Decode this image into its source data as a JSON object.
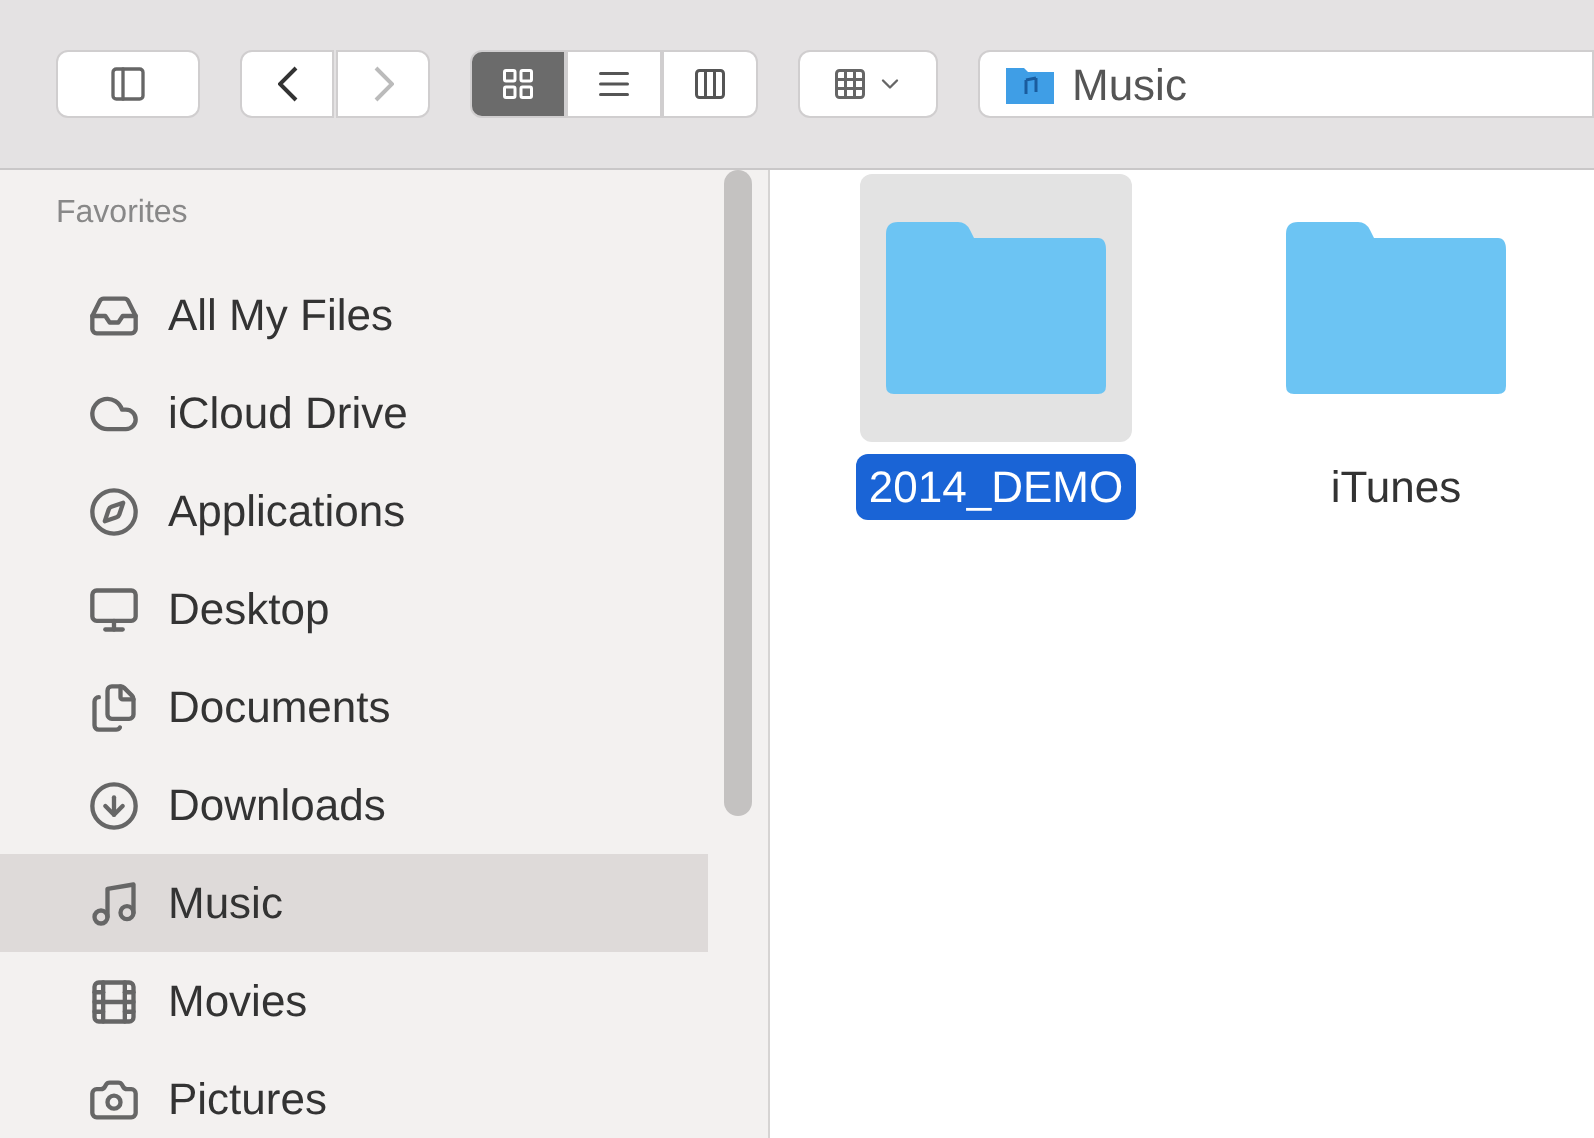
{
  "toolbar": {
    "view_modes": [
      {
        "kind": "icon",
        "selected": true
      },
      {
        "kind": "list",
        "selected": false
      },
      {
        "kind": "columns",
        "selected": false
      }
    ],
    "path": "Music"
  },
  "sidebar": {
    "heading": "Favorites",
    "items": [
      {
        "label": "All My Files",
        "kind": "files",
        "selected": false
      },
      {
        "label": "iCloud Drive",
        "kind": "cloud",
        "selected": false
      },
      {
        "label": "Applications",
        "kind": "apps",
        "selected": false
      },
      {
        "label": "Desktop",
        "kind": "desktop",
        "selected": false
      },
      {
        "label": "Documents",
        "kind": "documents",
        "selected": false
      },
      {
        "label": "Downloads",
        "kind": "downloads",
        "selected": false
      },
      {
        "label": "Music",
        "kind": "music",
        "selected": true
      },
      {
        "label": "Movies",
        "kind": "movies",
        "selected": false
      },
      {
        "label": "Pictures",
        "kind": "pictures",
        "selected": false
      }
    ]
  },
  "files": [
    {
      "name": "2014_DEMO",
      "selected": true
    },
    {
      "name": "iTunes",
      "selected": false
    }
  ]
}
